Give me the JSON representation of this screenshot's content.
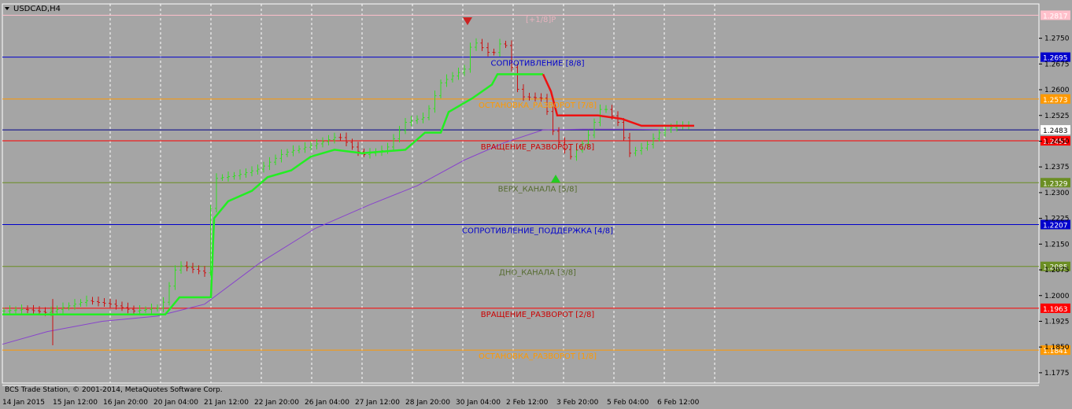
{
  "chart_title": "USDCAD,H4",
  "top_label": "[+1/8]P",
  "copyright": "BCS Trade Station, © 2001-2014, MetaQuotes Software Corp.",
  "colors": {
    "background": "#a5a5a5",
    "bull_candle": "#33dd22",
    "bear_candle": "#cc1111",
    "trailing_line_green": "#22ee22",
    "trailing_line_red": "#ee1111",
    "moving_average": "#8844cc",
    "blue_level": "#0000cc",
    "red_level": "#ff0000",
    "orange_level": "#ff9900",
    "olive_level": "#6b8e23",
    "pink_level": "#ffc0cb"
  },
  "levels": [
    {
      "price": 1.2817,
      "badge": "1.2817",
      "label": "",
      "color": "#ffc0cb",
      "text_color": "#e5b5c0"
    },
    {
      "price": 1.2695,
      "badge": "1.2695",
      "label": "СОПРОТИВЛЕНИЕ [8/8]",
      "color": "#0000cc",
      "text_color": "#0000cc"
    },
    {
      "price": 1.2573,
      "badge": "1.2573",
      "label": "ОСТАНОВКА_РАЗВОРОТ [7/8]",
      "color": "#ff9900",
      "text_color": "#ff9900"
    },
    {
      "price": 1.2451,
      "badge": "1.2451",
      "label": "ВРАЩЕНИЕ_РАЗВОРОТ [6/8]",
      "color": "#ff0000",
      "text_color": "#cc0000"
    },
    {
      "price": 1.2329,
      "badge": "1.2329",
      "label": "ВЕРХ_КАНАЛА [5/8]",
      "color": "#6b8e23",
      "text_color": "#556b2f"
    },
    {
      "price": 1.2207,
      "badge": "1.2207",
      "label": "СОПРОТИВЛЕНИЕ_ПОДДЕРЖКА [4/8]",
      "color": "#0000cc",
      "text_color": "#0000cc"
    },
    {
      "price": 1.2085,
      "badge": "1.2085",
      "label": "ДНО_КАНАЛА [3/8]",
      "color": "#6b8e23",
      "text_color": "#556b2f"
    },
    {
      "price": 1.1963,
      "badge": "1.1963",
      "label": "ВРАЩЕНИЕ_РАЗВОРОТ [2/8]",
      "color": "#ff0000",
      "text_color": "#cc0000"
    },
    {
      "price": 1.1841,
      "badge": "1.1841",
      "label": "ОСТАНОВКА_РАЗВОРОТ [1/8]",
      "color": "#ff9900",
      "text_color": "#ff9900"
    }
  ],
  "current_price": {
    "price": 1.2483,
    "badge": "1.2483"
  },
  "price_ticks": [
    "1.2750",
    "1.2675",
    "1.2600",
    "1.2525",
    "1.2450",
    "1.2375",
    "1.2300",
    "1.2225",
    "1.2150",
    "1.2075",
    "1.2000",
    "1.1925",
    "1.1850",
    "1.1775"
  ],
  "time_ticks": [
    "14 Jan 2015",
    "15 Jan 12:00",
    "16 Jan 20:00",
    "20 Jan 04:00",
    "21 Jan 12:00",
    "22 Jan 20:00",
    "26 Jan 04:00",
    "27 Jan 12:00",
    "28 Jan 20:00",
    "30 Jan 04:00",
    "2 Feb 12:00",
    "3 Feb 20:00",
    "5 Feb 04:00",
    "6 Feb 12:00"
  ]
}
